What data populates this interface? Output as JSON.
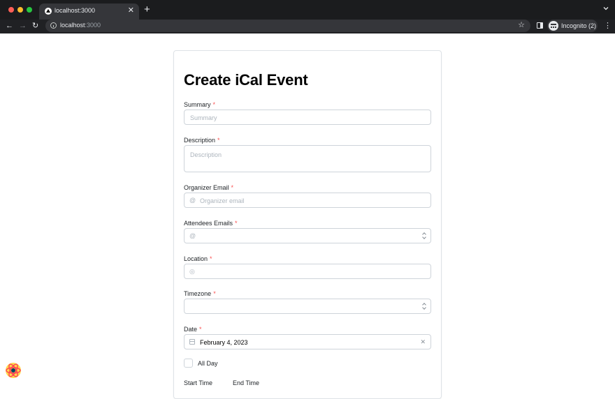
{
  "browser": {
    "tab_title": "localhost:3000",
    "url_host": "localhost",
    "url_port": ":3000",
    "profile_label": "Incognito (2)"
  },
  "form": {
    "title": "Create iCal Event",
    "required_marker": "*",
    "summary": {
      "label": "Summary",
      "placeholder": "Summary"
    },
    "description": {
      "label": "Description",
      "placeholder": "Description"
    },
    "organizer_email": {
      "label": "Organizer Email",
      "placeholder": "Organizer email",
      "icon": "at-icon"
    },
    "attendees_emails": {
      "label": "Attendees Emails",
      "icon": "at-icon"
    },
    "location": {
      "label": "Location",
      "icon": "location-icon"
    },
    "timezone": {
      "label": "Timezone"
    },
    "date": {
      "label": "Date",
      "value": "February 4, 2023",
      "icon": "calendar-icon"
    },
    "all_day": {
      "label": "All Day",
      "checked": false
    },
    "start_time": {
      "label": "Start Time"
    },
    "end_time": {
      "label": "End Time"
    }
  },
  "colors": {
    "required": "#fa5252",
    "border": "#ced4da",
    "placeholder": "#adb5bd"
  }
}
